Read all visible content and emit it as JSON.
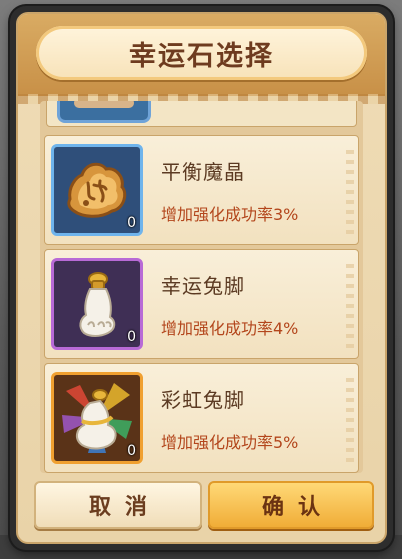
{
  "dialog": {
    "title": "幸运石选择"
  },
  "items": [
    {
      "name": "平衡魔晶",
      "description": "增加强化成功率3%",
      "count": "0",
      "icon": "balance-crystal-icon",
      "frame_color": "#6fb4ec",
      "success_rate_bonus_pct": 3
    },
    {
      "name": "幸运兔脚",
      "description": "增加强化成功率4%",
      "count": "0",
      "icon": "lucky-rabbit-foot-icon",
      "frame_color": "#b86ad6",
      "success_rate_bonus_pct": 4
    },
    {
      "name": "彩虹兔脚",
      "description": "增加强化成功率5%",
      "count": "0",
      "icon": "rainbow-rabbit-foot-icon",
      "frame_color": "#f0a030",
      "success_rate_bonus_pct": 5
    }
  ],
  "buttons": {
    "cancel_label": "取消",
    "confirm_label": "确认"
  },
  "colors": {
    "title_text": "#6e3b1f",
    "item_name": "#5b3a22",
    "item_desc": "#b3461c",
    "confirm_button": "#f0ad37"
  }
}
